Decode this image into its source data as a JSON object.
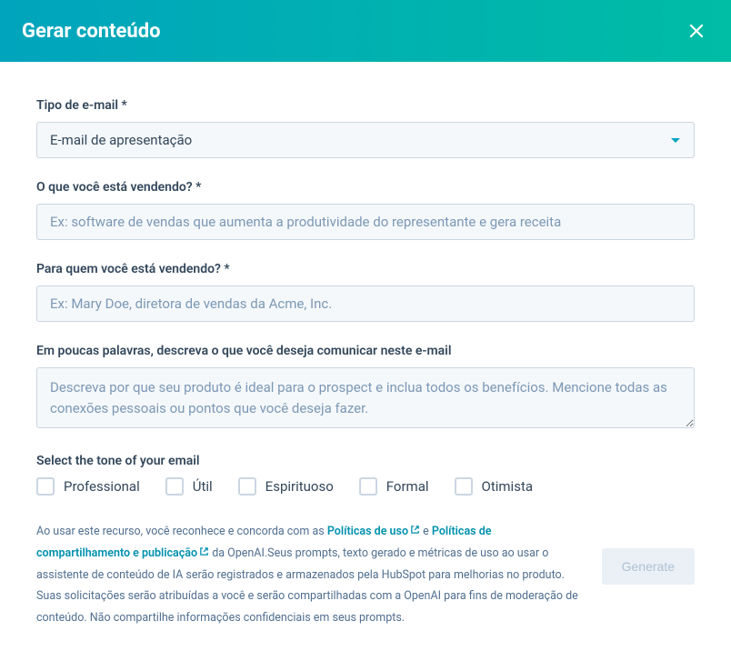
{
  "header": {
    "title": "Gerar conteúdo"
  },
  "fields": {
    "emailType": {
      "label": "Tipo de e-mail *",
      "value": "E-mail de apresentação"
    },
    "selling": {
      "label": "O que você está vendendo? *",
      "placeholder": "Ex: software de vendas que aumenta a produtividade do representante e gera receita"
    },
    "toWhom": {
      "label": "Para quem você está vendendo? *",
      "placeholder": "Ex: Mary Doe, diretora de vendas da Acme, Inc."
    },
    "describe": {
      "label": "Em poucas palavras, descreva o que você deseja comunicar neste e-mail",
      "placeholder": "Descreva por que seu produto é ideal para o prospect e inclua todos os benefícios. Mencione todas as conexões pessoais ou pontos que você deseja fazer."
    },
    "tone": {
      "label": "Select the tone of your email",
      "options": [
        "Professional",
        "Útil",
        "Espirituoso",
        "Formal",
        "Otimista"
      ]
    }
  },
  "disclaimer": {
    "part1": "Ao usar este recurso, você reconhece e concorda com as ",
    "link1": "Políticas de uso",
    "part2": " e ",
    "link2": "Políticas de compartilhamento e publicação",
    "part3": " da OpenAI.Seus prompts, texto gerado e métricas de uso ao usar o assistente de conteúdo de IA serão registrados e armazenados pela HubSpot para melhorias no produto. Suas solicitações serão atribuídas a você e serão compartilhadas com a OpenAI para fins de moderação de conteúdo. Não compartilhe informações confidenciais em seus prompts."
  },
  "buttons": {
    "generate": "Generate"
  }
}
